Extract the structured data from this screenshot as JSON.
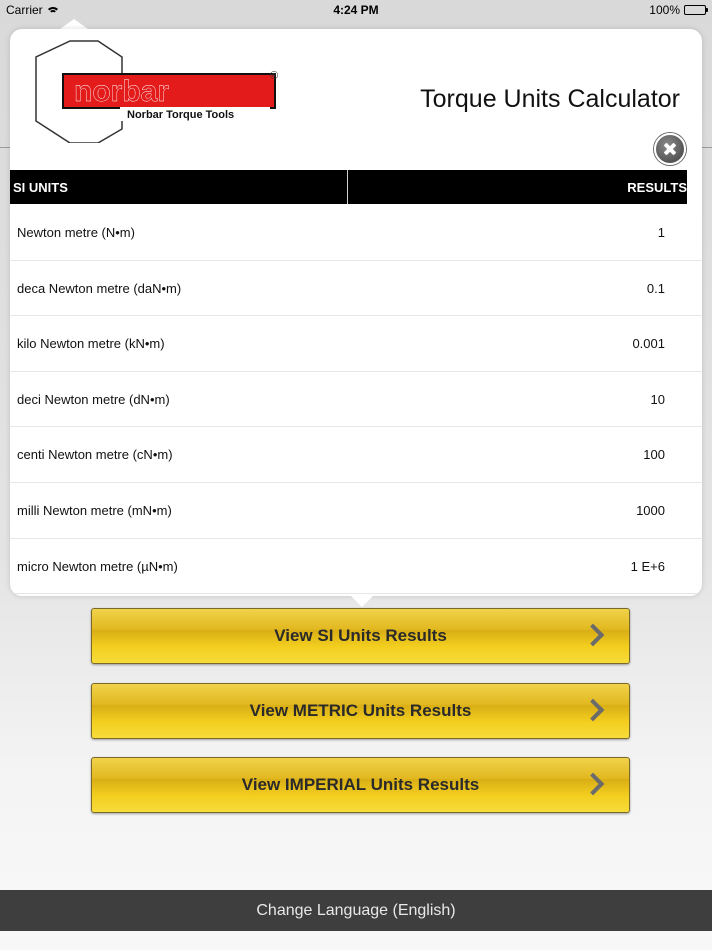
{
  "status_bar": {
    "carrier": "Carrier",
    "time": "4:24 PM",
    "battery": "100%"
  },
  "popover": {
    "title": "Torque Units Calculator",
    "logo": {
      "brand": "norbar",
      "tagline": "Norbar Torque Tools",
      "registered": "®"
    },
    "table": {
      "col_units": "SI UNITS",
      "col_results": "RESULTS",
      "rows": [
        {
          "unit": "Newton metre (N•m)",
          "value": "1"
        },
        {
          "unit": "deca Newton metre (daN•m)",
          "value": "0.1"
        },
        {
          "unit": "kilo Newton metre (kN•m)",
          "value": "0.001"
        },
        {
          "unit": "deci Newton metre (dN•m)",
          "value": "10"
        },
        {
          "unit": "centi Newton metre (cN•m)",
          "value": "100"
        },
        {
          "unit": "milli Newton metre (mN•m)",
          "value": "1000"
        },
        {
          "unit": "micro Newton metre (µN•m)",
          "value": "1 E+6"
        }
      ]
    }
  },
  "buttons": {
    "si": "View SI Units Results",
    "metric": "View METRIC Units Results",
    "imperial": "View IMPERIAL Units Results"
  },
  "language_bar": {
    "label": "Change Language (English)"
  },
  "colors": {
    "brand_red": "#e31b1b",
    "button_gold": "#e2b820",
    "bar_dark": "#3e3e3e"
  }
}
